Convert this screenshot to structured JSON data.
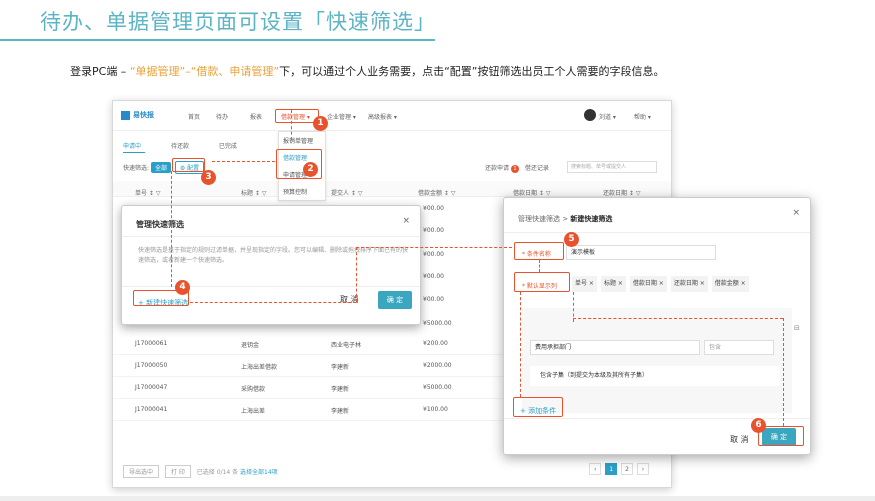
{
  "slide": {
    "title": "待办、单据管理页面可设置「快速筛选」",
    "subtitle_pre": "登录PC端 – ",
    "subtitle_hl1": "“单据管理”–“借款、申请管理”",
    "subtitle_post": "下，可以通过个人业务需要，点击“配置”按钮筛选出员工个人需要的字段信息。"
  },
  "app": {
    "logo": "易快报",
    "nav": [
      "首页",
      "待办",
      "报表",
      "借款管理 ▾",
      "企业管理 ▾",
      "高级报表 ▾"
    ],
    "user": "刘道 ▾",
    "help": "帮助 ▾",
    "dropdown": [
      "报销单管理",
      "借款管理",
      "申请管理",
      "预算控制"
    ],
    "tabs": [
      "申请中",
      "待还款",
      "已完成"
    ],
    "filter_label": "快速筛选:",
    "filter_all": "全部",
    "filter_config": "⚙ 配置",
    "loans_label": "还款申请",
    "loans_count": "1",
    "records_label": "借还记录",
    "search_placeholder": "搜索标题、单号或提交人",
    "columns": [
      "单号 ↕ ▽",
      "标题 ↕ ▽",
      "提交人 ↕ ▽",
      "借款金额 ↕ ▽",
      "借款日期 ↕ ▽",
      "还款日期 ↕ ▽"
    ],
    "rows": [
      {
        "no": "J17000061",
        "title": "退钥金",
        "person": "西业电子林",
        "amt": "¥200.00"
      },
      {
        "no": "J17000050",
        "title": "上海出差借款",
        "person": "李建新",
        "amt": "¥2000.00"
      },
      {
        "no": "J17000047",
        "title": "采购借款",
        "person": "李建新",
        "amt": "¥5000.00"
      },
      {
        "no": "J17000041",
        "title": "上海出差",
        "person": "李建新",
        "amt": "¥100.00"
      }
    ],
    "partial_amounts": [
      "¥00.00",
      "¥00.00",
      "¥00.00",
      "¥00.00",
      "¥00.00",
      "¥5000.00"
    ],
    "footer_export": "导出选中",
    "footer_print": "打 印",
    "footer_selected": "已选择 0/14 条",
    "footer_select_all": "选择全部14项",
    "pages": [
      "‹",
      "1",
      "2",
      "›"
    ]
  },
  "dialog1": {
    "title": "管理快速筛选",
    "close": "×",
    "desc": "快速筛选是基于指定的规则过滤单据，并呈现指定的字段。您可以编辑、删除或拖拽排序下面已有的快速筛选，或者新建一个快速筛选。",
    "new_link": "+ 新建快速筛选",
    "cancel": "取 消",
    "ok": "确 定"
  },
  "dialog2": {
    "crumb_parent": "管理快速筛选",
    "crumb_sep": " > ",
    "crumb_current": "新建快速筛选",
    "close": "×",
    "name_label": "* 条件名称",
    "name_value": "演示模板",
    "cols_label": "* 默认显示列",
    "col_tags": [
      "单号 ×",
      "标题 ×",
      "借款日期 ×",
      "还款日期 ×",
      "借款金额 ×"
    ],
    "cond_field": "费用承担部门",
    "cond_op": "包含",
    "cond_option": "包含子集（到提交为本级及其所有子集）",
    "add_condition": "+ 添加条件",
    "cancel": "取 消",
    "ok": "确 定"
  },
  "badges": [
    "1",
    "2",
    "3",
    "4",
    "5",
    "6"
  ],
  "colors": {
    "accent": "#5cb4c4",
    "highlight": "#e8a23b",
    "annotation": "#e8532d",
    "primary": "#2aa0c8"
  }
}
